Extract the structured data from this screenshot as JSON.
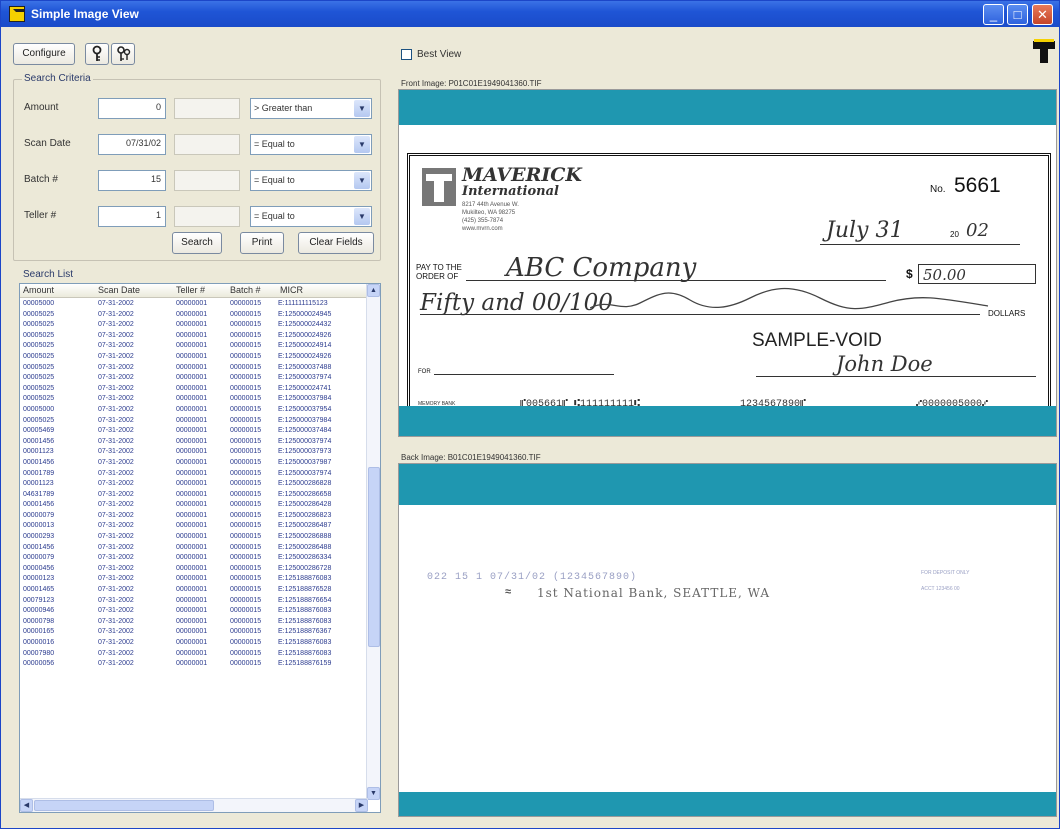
{
  "window": {
    "title": "Simple Image View",
    "min_btn": "_",
    "max_btn": "□",
    "close_btn": "✕"
  },
  "toolbar": {
    "configure_label": "Configure"
  },
  "search_criteria": {
    "legend": "Search Criteria",
    "rows": [
      {
        "label": "Amount",
        "value": "0",
        "operator": "> Greater than"
      },
      {
        "label": "Scan Date",
        "value": "07/31/02",
        "operator": "= Equal to"
      },
      {
        "label": "Batch #",
        "value": "15",
        "operator": "= Equal to"
      },
      {
        "label": "Teller #",
        "value": "1",
        "operator": "= Equal to"
      }
    ],
    "buttons": {
      "search": "Search",
      "print": "Print",
      "clear": "Clear Fields"
    }
  },
  "search_list": {
    "legend": "Search List",
    "columns": [
      "Amount",
      "Scan Date",
      "Teller #",
      "Batch #",
      "MICR"
    ],
    "rows": [
      [
        "00005000",
        "07-31-2002",
        "00000001",
        "00000015",
        "E:111111115123"
      ],
      [
        "00005025",
        "07-31-2002",
        "00000001",
        "00000015",
        "E:125000024945"
      ],
      [
        "00005025",
        "07-31-2002",
        "00000001",
        "00000015",
        "E:125000024432"
      ],
      [
        "00005025",
        "07-31-2002",
        "00000001",
        "00000015",
        "E:125000024926"
      ],
      [
        "00005025",
        "07-31-2002",
        "00000001",
        "00000015",
        "E:125000024914"
      ],
      [
        "00005025",
        "07-31-2002",
        "00000001",
        "00000015",
        "E:125000024926"
      ],
      [
        "00005025",
        "07-31-2002",
        "00000001",
        "00000015",
        "E:125000037488"
      ],
      [
        "00005025",
        "07-31-2002",
        "00000001",
        "00000015",
        "E:125000037974"
      ],
      [
        "00005025",
        "07-31-2002",
        "00000001",
        "00000015",
        "E:125000024741"
      ],
      [
        "00005025",
        "07-31-2002",
        "00000001",
        "00000015",
        "E:125000037984"
      ],
      [
        "00005000",
        "07-31-2002",
        "00000001",
        "00000015",
        "E:125000037954"
      ],
      [
        "00005025",
        "07-31-2002",
        "00000001",
        "00000015",
        "E:125000037984"
      ],
      [
        "00005469",
        "07-31-2002",
        "00000001",
        "00000015",
        "E:125000037484"
      ],
      [
        "00001456",
        "07-31-2002",
        "00000001",
        "00000015",
        "E:125000037974"
      ],
      [
        "00001123",
        "07-31-2002",
        "00000001",
        "00000015",
        "E:125000037973"
      ],
      [
        "00001456",
        "07-31-2002",
        "00000001",
        "00000015",
        "E:125000037987"
      ],
      [
        "00001789",
        "07-31-2002",
        "00000001",
        "00000015",
        "E:125000037974"
      ],
      [
        "00001123",
        "07-31-2002",
        "00000001",
        "00000015",
        "E:125000286828"
      ],
      [
        "04631789",
        "07-31-2002",
        "00000001",
        "00000015",
        "E:125000286658"
      ],
      [
        "00001456",
        "07-31-2002",
        "00000001",
        "00000015",
        "E:125000286428"
      ],
      [
        "00000079",
        "07-31-2002",
        "00000001",
        "00000015",
        "E:125000286823"
      ],
      [
        "00000013",
        "07-31-2002",
        "00000001",
        "00000015",
        "E:125000286487"
      ],
      [
        "00000293",
        "07-31-2002",
        "00000001",
        "00000015",
        "E:125000286888"
      ],
      [
        "00001456",
        "07-31-2002",
        "00000001",
        "00000015",
        "E:125000286488"
      ],
      [
        "00000079",
        "07-31-2002",
        "00000001",
        "00000015",
        "E:125000286334"
      ],
      [
        "00000456",
        "07-31-2002",
        "00000001",
        "00000015",
        "E:125000286728"
      ],
      [
        "00000123",
        "07-31-2002",
        "00000001",
        "00000015",
        "E:125188876083"
      ],
      [
        "00001465",
        "07-31-2002",
        "00000001",
        "00000015",
        "E:125188876528"
      ],
      [
        "00079123",
        "07-31-2002",
        "00000001",
        "00000015",
        "E:125188876654"
      ],
      [
        "00000946",
        "07-31-2002",
        "00000001",
        "00000015",
        "E:125188876083"
      ],
      [
        "00000798",
        "07-31-2002",
        "00000001",
        "00000015",
        "E:125188876083"
      ],
      [
        "00000165",
        "07-31-2002",
        "00000001",
        "00000015",
        "E:125188876367"
      ],
      [
        "00000016",
        "07-31-2002",
        "00000001",
        "00000015",
        "E:125188876083"
      ],
      [
        "00007980",
        "07-31-2002",
        "00000001",
        "00000015",
        "E:125188876083"
      ],
      [
        "00000056",
        "07-31-2002",
        "00000001",
        "00000015",
        "E:125188876159"
      ]
    ]
  },
  "viewer": {
    "best_view_label": "Best View",
    "front_label": "Front Image: P01C01E1949041360.TIF",
    "back_label": "Back Image: B01C01E1949041360.TIF"
  },
  "cheque": {
    "company": "MAVERICK",
    "company_sub": "International",
    "address": [
      "8217 44th Avenue W.",
      "Mukilteo, WA 98275",
      "(425) 355-7874",
      "www.mvrn.com"
    ],
    "no_label": "No.",
    "no_value": "5661",
    "date_handwritten": "July 31",
    "date_year_prefix": "20",
    "date_year": "02",
    "pay_label_1": "PAY TO THE",
    "pay_label_2": "ORDER OF",
    "payee": "ABC Company",
    "dollar_sign": "$",
    "amount": "50.00",
    "written_amount": "Fifty and 00/100",
    "dollars_label": "DOLLARS",
    "void_text": "SAMPLE-VOID",
    "for_label": "FOR",
    "signature": "John Doe",
    "micr_left": "MEMORY BANK",
    "micr_check": "⑈005661⑈ ⑆111111111⑆",
    "micr_account": "1234567890⑈",
    "micr_amount": "⑇0000005000⑇"
  },
  "back": {
    "line1": "022  15  1  07/31/02  (1234567890)",
    "line2": "1st National Bank, SEATTLE, WA",
    "endorse_1": "FOR DEPOSIT ONLY",
    "endorse_2": "ACCT 123456 00"
  },
  "colors": {
    "teal": "#1f97b0",
    "title_bar": "#1f55d6",
    "micr_text": "#2b3b8f",
    "logo_yellow": "#f5d100"
  }
}
